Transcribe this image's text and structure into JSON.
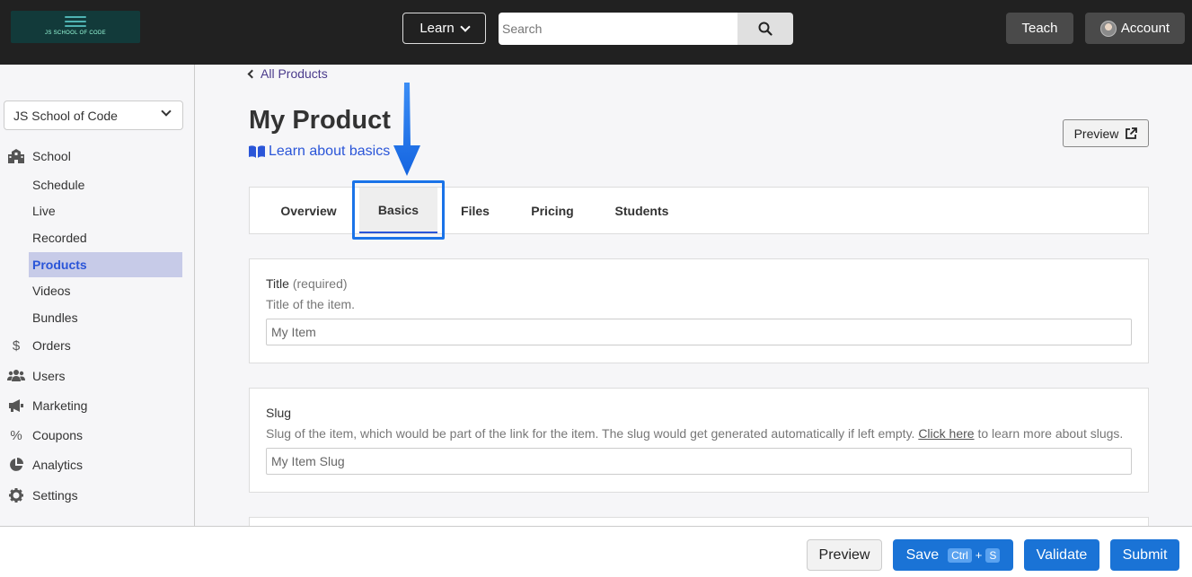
{
  "header": {
    "logo_text": "JS SCHOOL OF CODE",
    "learn_label": "Learn",
    "search_placeholder": "Search",
    "teach_label": "Teach",
    "account_label": "Account"
  },
  "sidebar": {
    "school_select": "JS School of Code",
    "school_section": "School",
    "sub_items": [
      "Schedule",
      "Live",
      "Recorded",
      "Products",
      "Videos",
      "Bundles"
    ],
    "active_item": "Products",
    "main_items": [
      "Orders",
      "Users",
      "Marketing",
      "Coupons",
      "Analytics",
      "Settings"
    ]
  },
  "main": {
    "back_link": "All Products",
    "title": "My Product",
    "learn_link": "Learn about basics",
    "preview_label": "Preview",
    "tabs": [
      "Overview",
      "Basics",
      "Files",
      "Pricing",
      "Students"
    ],
    "active_tab": "Basics",
    "title_field": {
      "label": "Title",
      "required": "(required)",
      "description": "Title of the item.",
      "placeholder": "My Item"
    },
    "slug_field": {
      "label": "Slug",
      "description_start": "Slug of the item, which would be part of the link for the item. The slug would get generated automatically if left empty.",
      "link_text": "Click here",
      "description_end": "to learn more about slugs.",
      "placeholder": "My Item Slug"
    }
  },
  "footer": {
    "preview_label": "Preview",
    "save_label": "Save",
    "save_kbd_ctrl": "Ctrl",
    "save_kbd_plus": "+",
    "save_kbd_key": "S",
    "validate_label": "Validate",
    "submit_label": "Submit"
  },
  "colors": {
    "topbar": "#212121",
    "primary": "#1a73d6",
    "accent_link": "#2a55d8",
    "highlight": "#1a73e8",
    "active_nav_bg": "#c7cbe8"
  },
  "icons": {
    "search": "search-icon",
    "school": "building-icon",
    "orders": "dollar-icon",
    "users": "users-icon",
    "marketing": "bullhorn-icon",
    "coupons": "percent-icon",
    "analytics": "pie-chart-icon",
    "settings": "gear-icon",
    "learn_link": "book-icon",
    "preview": "external-link-icon"
  }
}
